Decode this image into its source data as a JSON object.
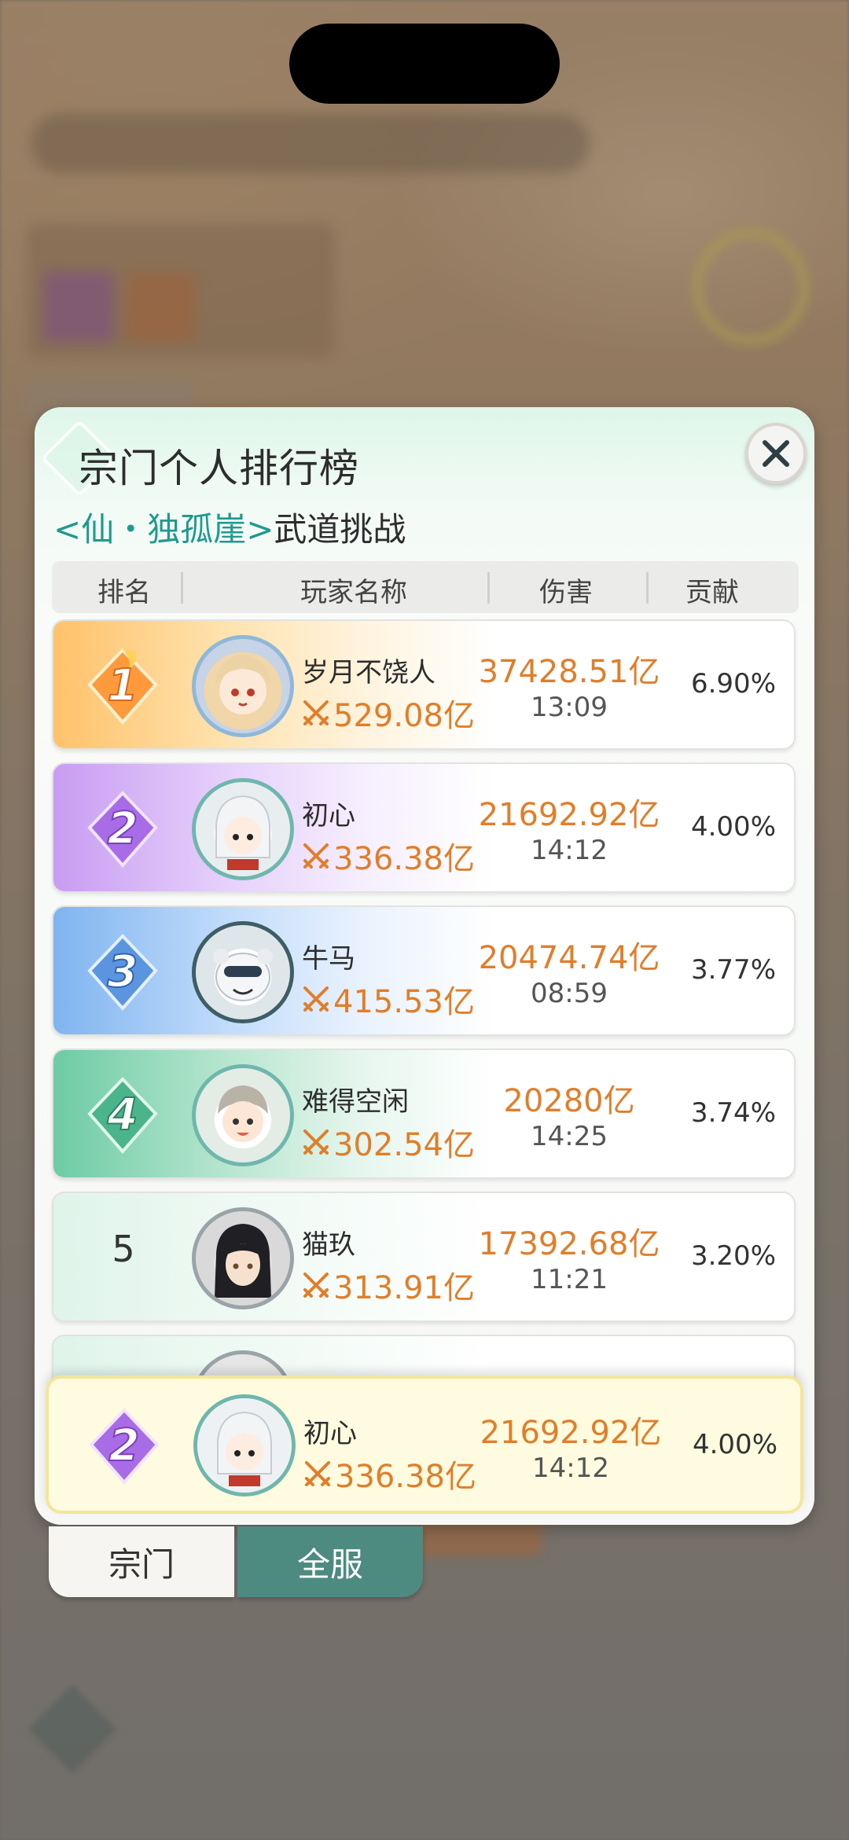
{
  "panel": {
    "title": "宗门个人排行榜",
    "subtitle_sect": "<仙・独孤崖>",
    "subtitle_event": "武道挑战"
  },
  "table": {
    "headers": [
      "排名",
      "玩家名称",
      "伤害",
      "贡献"
    ],
    "rows": [
      {
        "rank": "1",
        "name": "岁月不饶人",
        "power": "529.08亿",
        "damage": "37428.51亿",
        "time": "13:09",
        "contribution": "6.90%"
      },
      {
        "rank": "2",
        "name": "初心",
        "power": "336.38亿",
        "damage": "21692.92亿",
        "time": "14:12",
        "contribution": "4.00%"
      },
      {
        "rank": "3",
        "name": "牛马",
        "power": "415.53亿",
        "damage": "20474.74亿",
        "time": "08:59",
        "contribution": "3.77%"
      },
      {
        "rank": "4",
        "name": "难得空闲",
        "power": "302.54亿",
        "damage": "20280亿",
        "time": "14:25",
        "contribution": "3.74%"
      },
      {
        "rank": "5",
        "name": "猫玖",
        "power": "313.91亿",
        "damage": "17392.68亿",
        "time": "11:21",
        "contribution": "3.20%"
      }
    ]
  },
  "my_rank": {
    "rank": "2",
    "name": "初心",
    "power": "336.38亿",
    "damage": "21692.92亿",
    "time": "14:12",
    "contribution": "4.00%"
  },
  "tabs": {
    "sect": "宗门",
    "all_server": "全服",
    "active": "all_server"
  },
  "colors": {
    "accent": "#1f9a8e",
    "damage": "#e07e2a",
    "tab_active": "#4d8a80"
  }
}
